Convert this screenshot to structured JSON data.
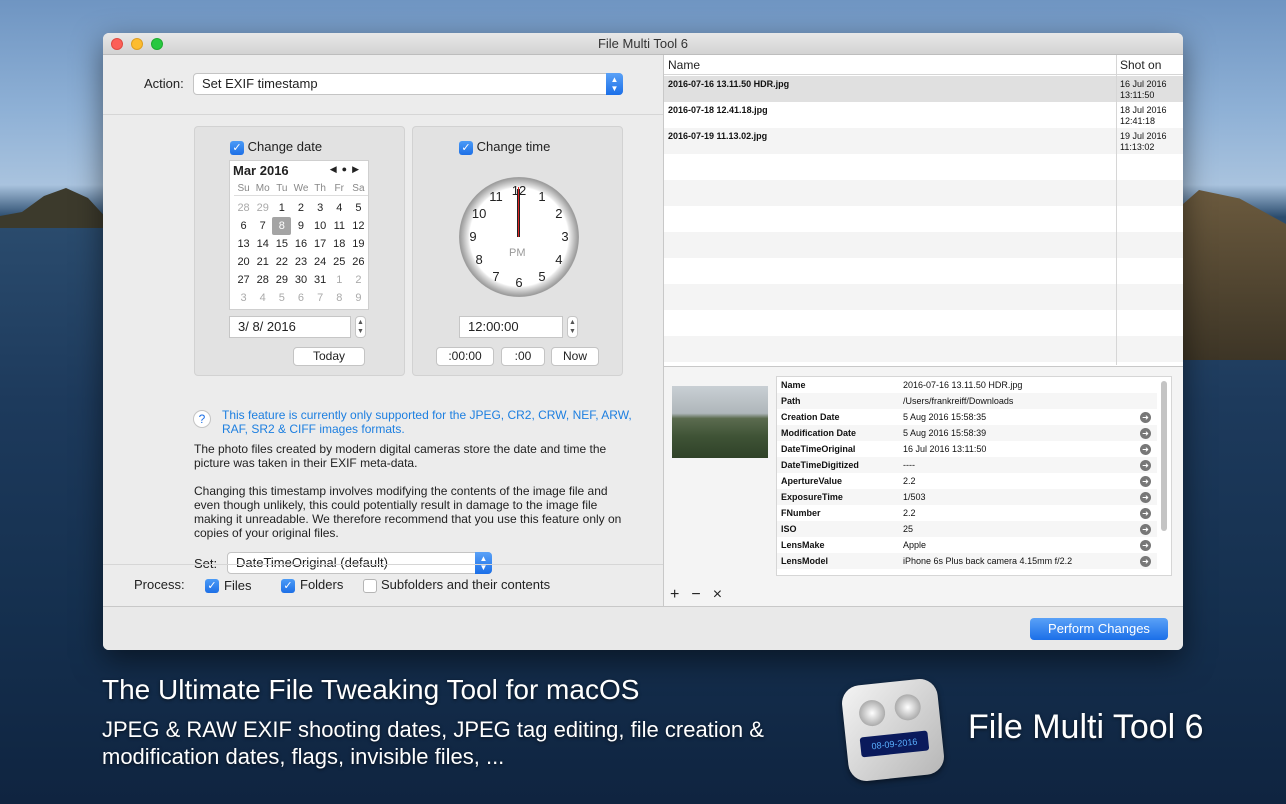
{
  "window": {
    "title": "File Multi Tool 6"
  },
  "action": {
    "label": "Action:",
    "value": "Set EXIF timestamp"
  },
  "date_panel": {
    "checkbox_label": "Change date",
    "month": "Mar 2016",
    "dow": [
      "Su",
      "Mo",
      "Tu",
      "We",
      "Th",
      "Fr",
      "Sa"
    ],
    "weeks": [
      [
        "28",
        "29",
        "1",
        "2",
        "3",
        "4",
        "5"
      ],
      [
        "6",
        "7",
        "8",
        "9",
        "10",
        "11",
        "12"
      ],
      [
        "13",
        "14",
        "15",
        "16",
        "17",
        "18",
        "19"
      ],
      [
        "20",
        "21",
        "22",
        "23",
        "24",
        "25",
        "26"
      ],
      [
        "27",
        "28",
        "29",
        "30",
        "31",
        "1",
        "2"
      ],
      [
        "3",
        "4",
        "5",
        "6",
        "7",
        "8",
        "9"
      ]
    ],
    "date_value": "3/  8/ 2016",
    "today_button": "Today"
  },
  "time_panel": {
    "checkbox_label": "Change time",
    "clock_numbers": [
      "12",
      "1",
      "2",
      "3",
      "4",
      "5",
      "6",
      "7",
      "8",
      "9",
      "10",
      "11"
    ],
    "pm": "PM",
    "time_value": "12:00:00",
    "btn1": ":00:00",
    "btn2": ":00",
    "btn3": "Now"
  },
  "help": {
    "icon": "?",
    "note": "This feature is currently only supported for the JPEG, CR2, CRW, NEF, ARW, RAF, SR2 & CIFF images formats."
  },
  "desc1": "The photo files created by modern digital cameras store the date and time the picture was taken in their EXIF meta-data.",
  "desc2": "Changing this timestamp involves modifying the contents of the image file and even though unlikely, this could potentially result in damage to the image file making it unreadable. We therefore recommend that you use this feature only on copies of your original files.",
  "set": {
    "label": "Set:",
    "value": "DateTimeOriginal (default)"
  },
  "process": {
    "label": "Process:",
    "files": "Files",
    "folders": "Folders",
    "subfolders": "Subfolders and their contents"
  },
  "files_table": {
    "headers": {
      "name": "Name",
      "shot": "Shot on"
    },
    "rows": [
      {
        "name": "2016-07-16 13.11.50 HDR.jpg",
        "date": "16 Jul 2016",
        "time": "13:11:50"
      },
      {
        "name": "2016-07-18 12.41.18.jpg",
        "date": "18 Jul 2016",
        "time": "12:41:18"
      },
      {
        "name": "2016-07-19 11.13.02.jpg",
        "date": "19 Jul 2016",
        "time": "11:13:02"
      }
    ]
  },
  "properties": [
    {
      "k": "Name",
      "v": "2016-07-16 13.11.50 HDR.jpg",
      "arrow": false
    },
    {
      "k": "Path",
      "v": "/Users/frankreiff/Downloads",
      "arrow": false
    },
    {
      "k": "Creation Date",
      "v": "5 Aug 2016 15:58:35",
      "arrow": true
    },
    {
      "k": "Modification Date",
      "v": "5 Aug 2016 15:58:39",
      "arrow": true
    },
    {
      "k": "DateTimeOriginal",
      "v": "16 Jul 2016 13:11:50",
      "arrow": true
    },
    {
      "k": "DateTimeDigitized",
      "v": "----",
      "arrow": true
    },
    {
      "k": "ApertureValue",
      "v": "2.2",
      "arrow": true
    },
    {
      "k": "ExposureTime",
      "v": "1/503",
      "arrow": true
    },
    {
      "k": "FNumber",
      "v": "2.2",
      "arrow": true
    },
    {
      "k": "ISO",
      "v": "25",
      "arrow": true
    },
    {
      "k": "LensMake",
      "v": "Apple",
      "arrow": true
    },
    {
      "k": "LensModel",
      "v": "iPhone 6s Plus back camera 4.15mm f/2.2",
      "arrow": true
    }
  ],
  "list_buttons": {
    "add": "+",
    "remove": "−",
    "clear": "×"
  },
  "perform_button": "Perform Changes",
  "promo": {
    "headline": "The Ultimate File Tweaking Tool for macOS",
    "line1": "JPEG & RAW EXIF shooting dates, JPEG tag editing, file creation &",
    "line2": "modification dates, flags, invisible files, ...",
    "app_name": "File Multi Tool 6",
    "icon_display": "08-09-2016"
  },
  "colors": {
    "accent": "#1d6fe6",
    "note_text": "#1d7fe0"
  }
}
